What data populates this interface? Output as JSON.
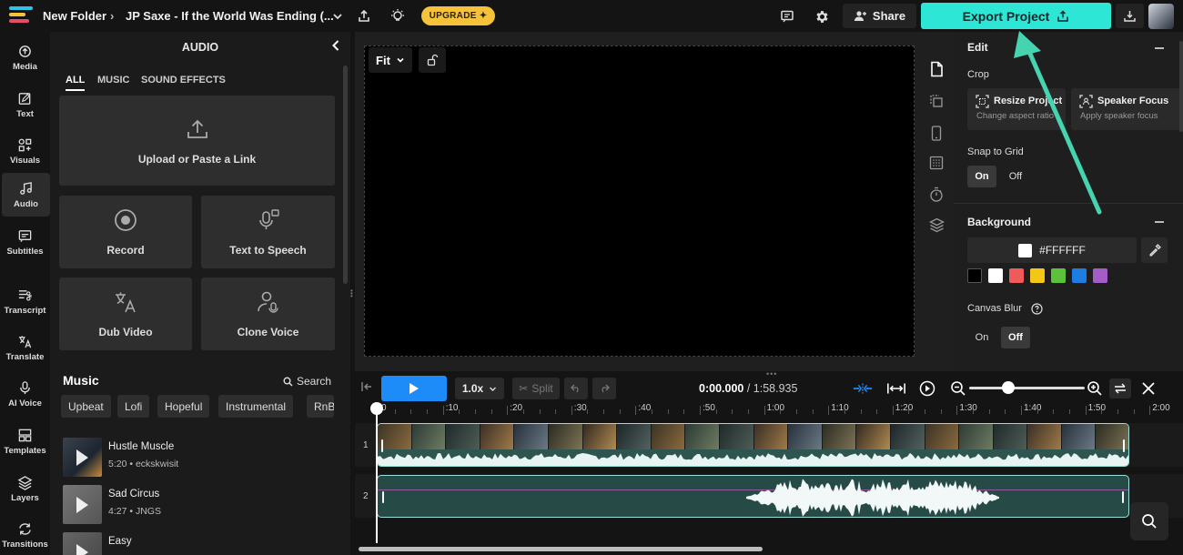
{
  "header": {
    "breadcrumb_folder": "New Folder",
    "breadcrumb_project": "JP Saxe - If the World Was Ending (...",
    "upgrade_label": "UPGRADE",
    "share_label": "Share",
    "export_label": "Export Project"
  },
  "rail": {
    "items": [
      {
        "label": "Media"
      },
      {
        "label": "Text"
      },
      {
        "label": "Visuals"
      },
      {
        "label": "Audio"
      },
      {
        "label": "Subtitles"
      },
      {
        "label": "Transcript"
      },
      {
        "label": "Translate"
      },
      {
        "label": "AI Voice"
      },
      {
        "label": "Templates"
      },
      {
        "label": "Layers"
      },
      {
        "label": "Transitions"
      }
    ]
  },
  "audio_panel": {
    "title": "AUDIO",
    "tabs": [
      "ALL",
      "MUSIC",
      "SOUND EFFECTS"
    ],
    "upload_label": "Upload or Paste a Link",
    "tiles": [
      "Record",
      "Text to Speech",
      "Dub Video",
      "Clone Voice"
    ],
    "music_heading": "Music",
    "search_label": "Search",
    "chips": [
      "Upbeat",
      "Lofi",
      "Hopeful",
      "Instrumental",
      "RnB"
    ],
    "tracks": [
      {
        "name": "Hustle Muscle",
        "meta": "5:20 • eckskwisit"
      },
      {
        "name": "Sad Circus",
        "meta": "4:27 • JNGS"
      },
      {
        "name": "Easy",
        "meta": ""
      }
    ]
  },
  "stage": {
    "fit_label": "Fit"
  },
  "edit_panel": {
    "edit_heading": "Edit",
    "crop_label": "Crop",
    "resize_title": "Resize Project",
    "resize_sub": "Change aspect ratio",
    "speaker_title": "Speaker Focus",
    "speaker_sub": "Apply speaker focus",
    "snap_label": "Snap to Grid",
    "on_label": "On",
    "off_label": "Off",
    "background_heading": "Background",
    "bg_hex": "#FFFFFF",
    "swatches": [
      "#000000",
      "#ffffff",
      "#f05a5a",
      "#f5c518",
      "#5cc23a",
      "#1e7de0",
      "#a45cc8"
    ],
    "canvas_blur_label": "Canvas Blur",
    "blur_on_label": "On",
    "blur_off_label": "Off"
  },
  "timeline": {
    "speed_label": "1.0x",
    "split_label": "Split",
    "current_time": "0:00.000",
    "duration": "/ 1:58.935",
    "zoom_level": 0.34,
    "ruler": [
      "0",
      ":10",
      ":20",
      ":30",
      ":40",
      ":50",
      "1:00",
      "1:10",
      "1:20",
      "1:30",
      "1:40",
      "1:50",
      "2:00"
    ],
    "track_numbers": [
      "1",
      "2"
    ]
  },
  "colors": {
    "accent_export": "#2ee6d6",
    "play_blue": "#1d8cf8",
    "upgrade_yellow": "#f6c23a",
    "annotation_arrow": "#46d3b0"
  }
}
